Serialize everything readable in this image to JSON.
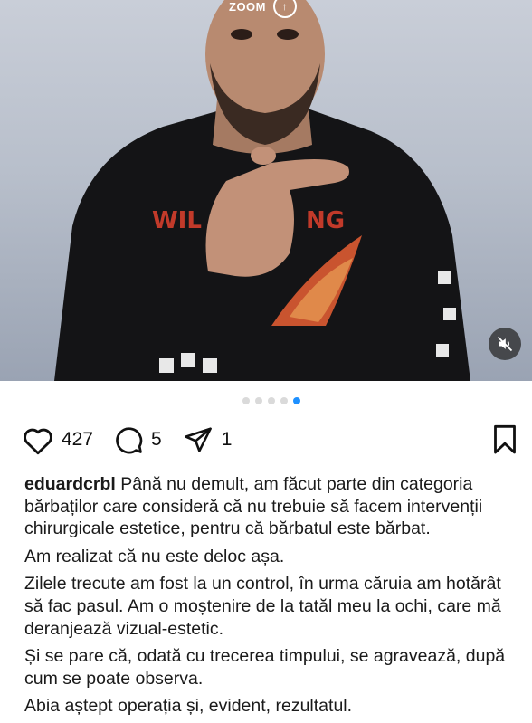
{
  "media": {
    "zoom_label": "ZOOM",
    "zoom_icon_glyph": "↑",
    "mute_icon": "speaker-muted-icon",
    "photo_description_hidden": true
  },
  "carousel": {
    "total": 5,
    "active_index": 4
  },
  "actions": {
    "likes": "427",
    "comments": "5",
    "shares": "1"
  },
  "caption": {
    "username": "eduardcrbl",
    "paragraphs": [
      "Până nu demult, am făcut parte din categoria bărbaților care consideră că nu trebuie să facem intervenții chirurgicale estetice, pentru că bărbatul este bărbat.",
      "Am realizat că nu este deloc așa.",
      "Zilele trecute am fost la un control, în urma căruia am hotărât să fac pasul. Am o moștenire de la tatăl meu la ochi, care mă deranjează vizual-estetic.",
      "Și se pare că, odată cu trecerea timpului, se agravează, după cum se poate observa.",
      "Abia aștept operația și, evident, rezultatul."
    ]
  },
  "colors": {
    "accent_dot": "#1e90ff",
    "icon": "#111111"
  }
}
